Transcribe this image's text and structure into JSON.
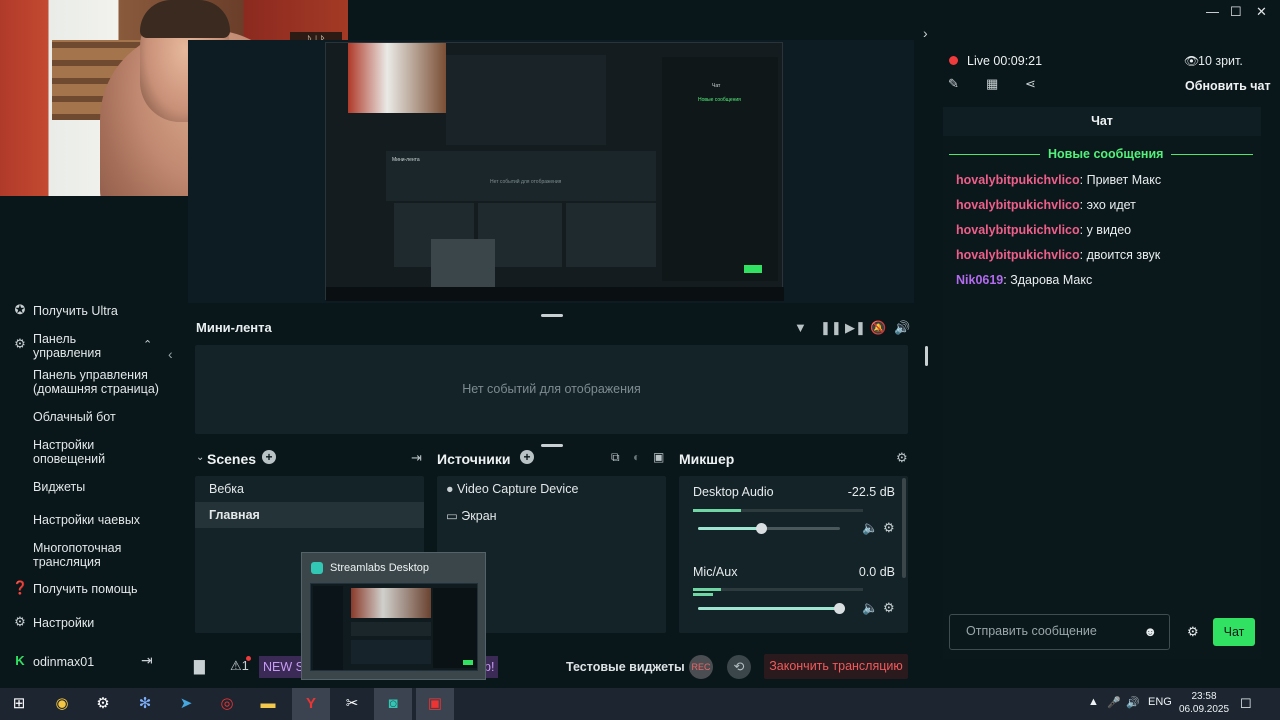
{
  "preview": {
    "inner_title": "Мини-лента",
    "inner_empty": "Нет событий для отображения",
    "inner_chat": "Чат",
    "inner_new": "Новые сообщения"
  },
  "sidebar": {
    "items": [
      {
        "label": "Получить Ultra",
        "icon": "ultra-icon"
      },
      {
        "label": "Панель управления",
        "icon": "dashboard-icon"
      },
      {
        "label": "Панель управления (домашняя страница)"
      },
      {
        "label": "Облачный бот"
      },
      {
        "label": "Настройки оповещений"
      },
      {
        "label": "Виджеты"
      },
      {
        "label": "Настройки чаевых"
      },
      {
        "label": "Многопоточная трансляция"
      },
      {
        "label": "Получить помощь",
        "icon": "help-icon"
      },
      {
        "label": "Настройки",
        "icon": "settings-icon"
      }
    ],
    "user": "odinmax01"
  },
  "mini_feed": {
    "title": "Мини-лента",
    "empty": "Нет событий для отображения"
  },
  "scenes": {
    "title": "Scenes",
    "items": [
      "Вебка",
      "Главная"
    ],
    "selected": "Главная"
  },
  "sources": {
    "title": "Источники",
    "items": [
      {
        "label": "Video Capture Device",
        "icon": "camera-icon"
      },
      {
        "label": "Экран",
        "icon": "monitor-icon"
      }
    ]
  },
  "mixer": {
    "title": "Микшер",
    "channels": [
      {
        "name": "Desktop Audio",
        "db": "-22.5 dB",
        "volume": 0.45
      },
      {
        "name": "Mic/Aux",
        "db": "0.0 dB",
        "volume": 1.0
      }
    ]
  },
  "bottom": {
    "new_badge": "NEW S",
    "bang": "p!",
    "test_widgets": "Тестовые виджеты",
    "rec": "REC",
    "end_stream": "Закончить трансляцию",
    "alerts_count": "1"
  },
  "popup": {
    "title": "Streamlabs Desktop"
  },
  "stream": {
    "live": "Live",
    "time": "00:09:21",
    "viewers": "10 зрит.",
    "refresh_chat": "Обновить чат"
  },
  "chat": {
    "header": "Чат",
    "new_messages": "Новые сообщения",
    "messages": [
      {
        "user": "hovalybitpukichvlico",
        "text": ": Привет Макс",
        "color": "#f05f8a"
      },
      {
        "user": "hovalybitpukichvlico",
        "text": ": эхо идет",
        "color": "#f05f8a"
      },
      {
        "user": "hovalybitpukichvlico",
        "text": ": у видео",
        "color": "#f05f8a"
      },
      {
        "user": "hovalybitpukichvlico",
        "text": ": двоится звук",
        "color": "#f05f8a"
      },
      {
        "user": "Nik0619",
        "text": ": Здарова Макс",
        "color": "#b36bf0"
      }
    ],
    "input_placeholder": "Отправить сообщение",
    "send": "Чат"
  },
  "taskbar": {
    "lang": "ENG",
    "time": "23:58",
    "date": "06.09.2025"
  },
  "colors": {
    "accent": "#31e262",
    "live": "#ef3b3b",
    "end_stream": "#f05a5a"
  }
}
